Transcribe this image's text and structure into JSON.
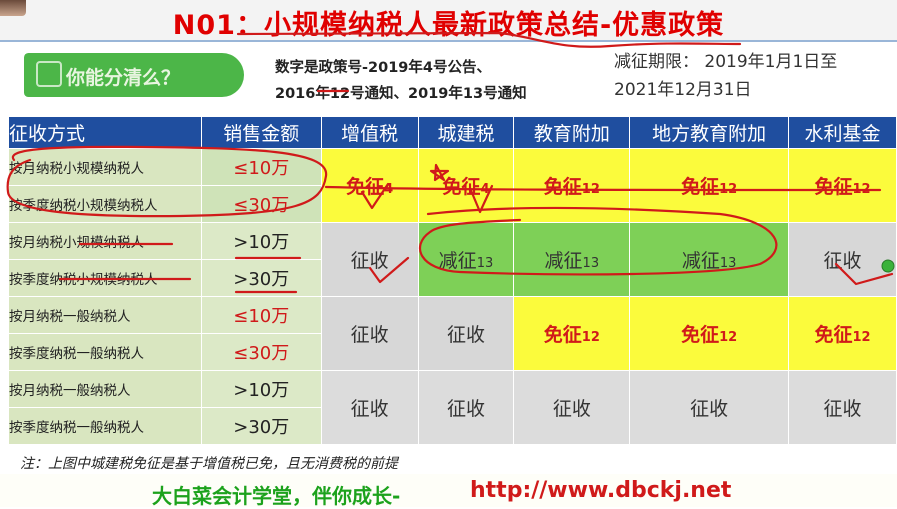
{
  "title": "N01：小规模纳税人最新政策总结-优惠政策",
  "banner": {
    "text": "你能分清么？"
  },
  "note": {
    "line1": "数字是政策号-2019年4号公告、",
    "line2": "2016年12号通知、2019年13号通知"
  },
  "period": {
    "line1": "减征期限： 2019年1月1日至",
    "line2": "2021年12月31日"
  },
  "table": {
    "headers": [
      "征收方式",
      "销售金额",
      "增值税",
      "城建税",
      "教育附加",
      "地方教育附加",
      "水利基金"
    ],
    "rows": [
      {
        "type": "按月纳税小规模纳税人",
        "amount": "≤10万",
        "vat": {
          "text": "免征",
          "num": "4"
        },
        "urban": {
          "text": "免征",
          "num": "4"
        },
        "edu": {
          "text": "免征",
          "num": "12"
        },
        "local_edu": {
          "text": "免征",
          "num": "12"
        },
        "water": {
          "text": "免征",
          "num": "12"
        }
      },
      {
        "type": "按季度纳税小规模纳税人",
        "amount": "≤30万"
      },
      {
        "type": "按月纳税小规模纳税人",
        "amount": ">10万",
        "vat": {
          "text": "征收"
        },
        "urban": {
          "text": "减征",
          "num": "13"
        },
        "edu": {
          "text": "减征",
          "num": "13"
        },
        "local_edu": {
          "text": "减征",
          "num": "13"
        },
        "water": {
          "text": "征收"
        }
      },
      {
        "type": "按季度纳税小规模纳税人",
        "amount": ">30万"
      },
      {
        "type": "按月纳税一般纳税人",
        "amount": "≤10万",
        "vat": {
          "text": "征收"
        },
        "urban": {
          "text": "征收"
        },
        "edu": {
          "text": "免征",
          "num": "12"
        },
        "local_edu": {
          "text": "免征",
          "num": "12"
        },
        "water": {
          "text": "免征",
          "num": "12"
        }
      },
      {
        "type": "按季度纳税一般纳税人",
        "amount": "≤30万"
      },
      {
        "type": "按月纳税一般纳税人",
        "amount": ">10万",
        "vat": {
          "text": "征收"
        },
        "urban": {
          "text": "征收"
        },
        "edu": {
          "text": "征收"
        },
        "local_edu": {
          "text": "征收"
        },
        "water": {
          "text": "征收"
        }
      },
      {
        "type": "按季度纳税一般纳税人",
        "amount": ">30万"
      }
    ]
  },
  "footnote": "注：上图中城建税免征是基于增值税已免，且无消费税的前提",
  "footer": {
    "cn": "大白菜会计学堂，伴你成长-",
    "url": "http://www.dbckj.net"
  },
  "colors": {
    "header_blue": "#1f4e9f",
    "title_red": "#e00000",
    "highlight_yellow": "#fbfb3c",
    "highlight_green": "#7ed057",
    "footer_green": "#1ca21c"
  }
}
